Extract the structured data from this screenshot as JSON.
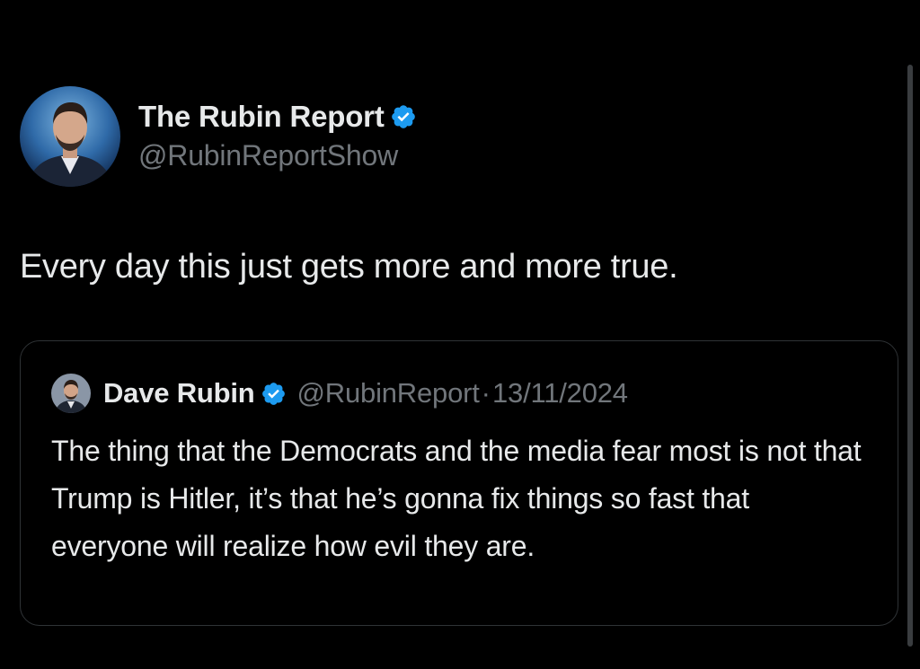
{
  "tweet": {
    "author": {
      "display_name": "The Rubin Report",
      "handle": "@RubinReportShow",
      "verified": true,
      "avatar_icon": "profile-photo"
    },
    "text": "Every day this just gets more and more true.",
    "quoted": {
      "author": {
        "display_name": "Dave Rubin",
        "handle": "@RubinReport",
        "verified": true,
        "avatar_icon": "profile-photo"
      },
      "separator": "·",
      "date": "13/11/2024",
      "text": "The thing that the Democrats and the media fear most is not that Trump is Hitler, it’s that he’s gonna fix things so fast that everyone will realize how evil they are."
    }
  },
  "colors": {
    "background": "#000000",
    "primary_text": "#e7e9ea",
    "secondary_text": "#71767b",
    "border": "#2f3336",
    "verified_badge": "#1d9bf0"
  }
}
